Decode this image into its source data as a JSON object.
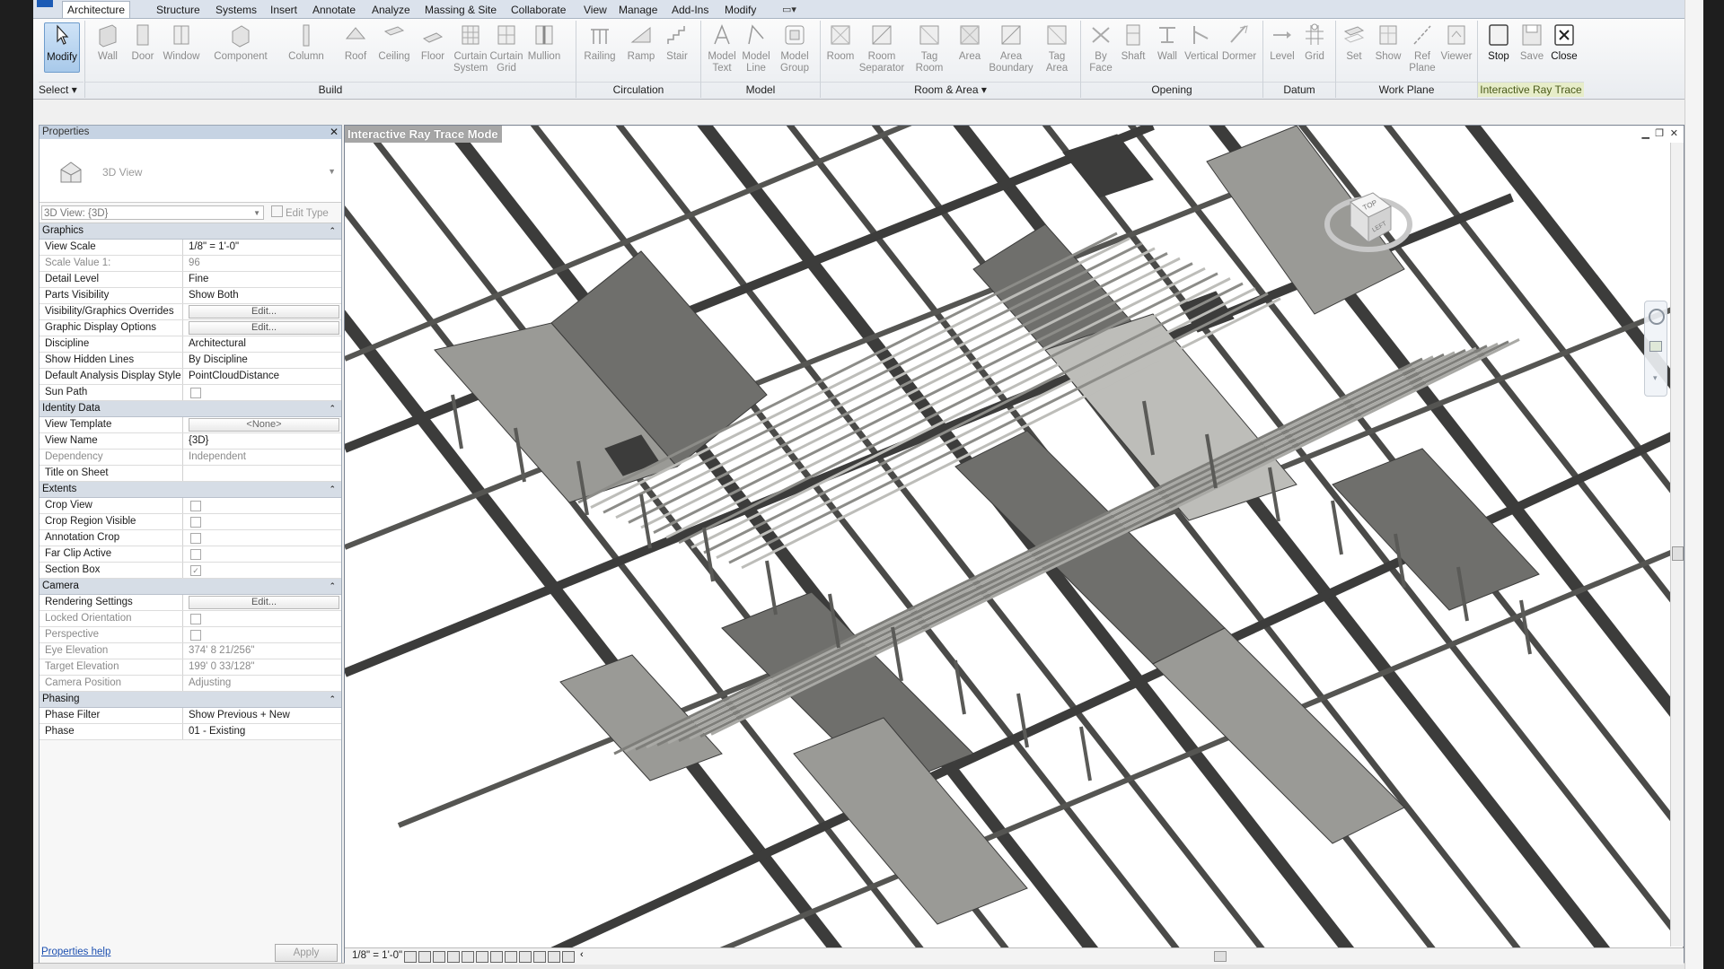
{
  "tabs": [
    "Architecture",
    "Structure",
    "Systems",
    "Insert",
    "Annotate",
    "Analyze",
    "Massing & Site",
    "Collaborate",
    "View",
    "Manage",
    "Add-Ins",
    "Modify"
  ],
  "active_tab": "Architecture",
  "ribbon": {
    "tools": [
      {
        "id": "modify",
        "label": "Modify"
      },
      {
        "id": "wall",
        "label": "Wall"
      },
      {
        "id": "door",
        "label": "Door"
      },
      {
        "id": "window",
        "label": "Window"
      },
      {
        "id": "component",
        "label": "Component"
      },
      {
        "id": "column",
        "label": "Column"
      },
      {
        "id": "roof",
        "label": "Roof"
      },
      {
        "id": "ceiling",
        "label": "Ceiling"
      },
      {
        "id": "floor",
        "label": "Floor"
      },
      {
        "id": "curtain-system",
        "label": "Curtain System"
      },
      {
        "id": "curtain-grid",
        "label": "Curtain Grid"
      },
      {
        "id": "mullion",
        "label": "Mullion"
      },
      {
        "id": "railing",
        "label": "Railing"
      },
      {
        "id": "ramp",
        "label": "Ramp"
      },
      {
        "id": "stair",
        "label": "Stair"
      },
      {
        "id": "model-text",
        "label": "Model Text"
      },
      {
        "id": "model-line",
        "label": "Model Line"
      },
      {
        "id": "model-group",
        "label": "Model Group"
      },
      {
        "id": "room",
        "label": "Room"
      },
      {
        "id": "room-separator",
        "label": "Room Separator"
      },
      {
        "id": "tag-room",
        "label": "Tag Room"
      },
      {
        "id": "area",
        "label": "Area"
      },
      {
        "id": "area-boundary",
        "label": "Area Boundary"
      },
      {
        "id": "tag-area",
        "label": "Tag Area"
      },
      {
        "id": "by-face",
        "label": "By Face"
      },
      {
        "id": "shaft",
        "label": "Shaft"
      },
      {
        "id": "wall-opening",
        "label": "Wall"
      },
      {
        "id": "vertical",
        "label": "Vertical"
      },
      {
        "id": "dormer",
        "label": "Dormer"
      },
      {
        "id": "level",
        "label": "Level"
      },
      {
        "id": "grid",
        "label": "Grid"
      },
      {
        "id": "set",
        "label": "Set"
      },
      {
        "id": "show",
        "label": "Show"
      },
      {
        "id": "ref-plane",
        "label": "Ref Plane"
      },
      {
        "id": "viewer",
        "label": "Viewer"
      },
      {
        "id": "stop",
        "label": "Stop"
      },
      {
        "id": "save",
        "label": "Save"
      },
      {
        "id": "close",
        "label": "Close"
      }
    ],
    "panels": {
      "select": "Select",
      "build": "Build",
      "circulation": "Circulation",
      "model": "Model",
      "room_area": "Room & Area",
      "opening": "Opening",
      "datum": "Datum",
      "work_plane": "Work Plane",
      "irt": "Interactive Ray Trace"
    }
  },
  "properties": {
    "title": "Properties",
    "type_name": "3D View",
    "view_selector": "3D View: {3D}",
    "edit_type": "Edit Type",
    "sections": {
      "graphics": "Graphics",
      "identity": "Identity Data",
      "extents": "Extents",
      "camera": "Camera",
      "phasing": "Phasing"
    },
    "graphics": [
      {
        "k": "View Scale",
        "v": "1/8\" = 1'-0\""
      },
      {
        "k": "Scale Value    1:",
        "v": "96"
      },
      {
        "k": "Detail Level",
        "v": "Fine"
      },
      {
        "k": "Parts Visibility",
        "v": "Show Both"
      },
      {
        "k": "Visibility/Graphics Overrides",
        "v": "Edit..."
      },
      {
        "k": "Graphic Display Options",
        "v": "Edit..."
      },
      {
        "k": "Discipline",
        "v": "Architectural"
      },
      {
        "k": "Show Hidden Lines",
        "v": "By Discipline"
      },
      {
        "k": "Default Analysis Display Style",
        "v": "PointCloudDistance"
      },
      {
        "k": "Sun Path",
        "v": ""
      }
    ],
    "identity": [
      {
        "k": "View Template",
        "v": "<None>"
      },
      {
        "k": "View Name",
        "v": "{3D}"
      },
      {
        "k": "Dependency",
        "v": "Independent"
      },
      {
        "k": "Title on Sheet",
        "v": ""
      }
    ],
    "extents": [
      {
        "k": "Crop View",
        "v": ""
      },
      {
        "k": "Crop Region Visible",
        "v": ""
      },
      {
        "k": "Annotation Crop",
        "v": ""
      },
      {
        "k": "Far Clip Active",
        "v": ""
      },
      {
        "k": "Section Box",
        "v": "✓"
      }
    ],
    "camera": [
      {
        "k": "Rendering Settings",
        "v": "Edit..."
      },
      {
        "k": "Locked Orientation",
        "v": ""
      },
      {
        "k": "Perspective",
        "v": ""
      },
      {
        "k": "Eye Elevation",
        "v": "374'  8 21/256\""
      },
      {
        "k": "Target Elevation",
        "v": "199'  0 33/128\""
      },
      {
        "k": "Camera Position",
        "v": "Adjusting"
      }
    ],
    "phasing": [
      {
        "k": "Phase Filter",
        "v": "Show Previous + New"
      },
      {
        "k": "Phase",
        "v": "01 - Existing"
      }
    ],
    "help": "Properties help",
    "apply": "Apply"
  },
  "view": {
    "label": "Interactive Ray Trace Mode",
    "scale": "1/8\" = 1'-0\"",
    "cube_top": "TOP",
    "cube_left": "LEFT"
  },
  "colors": {
    "ribbon_bg": "#f0f2f5",
    "irt_panel": "#e7edc9",
    "model_gray": "#6e6e6b"
  }
}
